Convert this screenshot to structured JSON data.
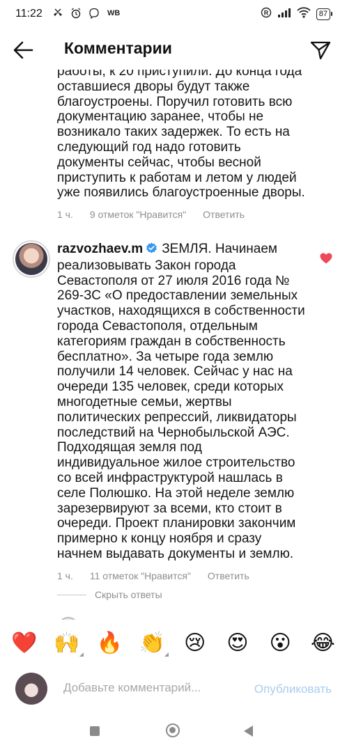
{
  "status_bar": {
    "time": "11:22",
    "carrier_tag": "WB",
    "battery_level": "87"
  },
  "header": {
    "title": "Комментарии"
  },
  "comments": [
    {
      "text": "работы, к 20 приступили. До конца года оставшиеся дворы будут также благоустроены. Поручил готовить всю документацию заранее, чтобы не возникало таких задержек. То есть на следующий год надо готовить документы сейчас, чтобы весной приступить к работам и летом у людей уже появились благоустроенные дворы.",
      "time": "1 ч.",
      "likes": "9 отметок \"Нравится\"",
      "reply": "Ответить"
    },
    {
      "username": "razvozhaev.m",
      "text": "ЗЕМЛЯ. Начинаем реализовывать Закон города Севастополя от 27 июля 2016 года № 269-ЗС «О предоставлении земельных участков, находящихся в собственности города Севастополя, отдельным категориям граждан в собственность бесплатно». За четыре года землю получили 14 человек. Сейчас у нас на очереди 135 человек, среди которых многодетные семьи, жертвы политических репрессий, ликвидаторы последствий на Чернобыльской АЭС. Подходящая земля под индивидуальное жилое строительство со всей инфраструктурой нашлась в селе Полюшко. На этой неделе землю зарезервируют за всеми, кто стоит в очереди. Проект планировки закончим примерно к концу ноября и сразу начнем выдавать документы и землю.",
      "time": "1 ч.",
      "likes": "11 отметок \"Нравится\"",
      "reply": "Ответить",
      "liked": true
    }
  ],
  "hide_replies": "Скрыть ответы",
  "emoji_bar": [
    "❤️",
    "🙌",
    "🔥",
    "👏",
    "😢",
    "😍",
    "😮",
    "😂"
  ],
  "composer": {
    "placeholder": "Добавьте комментарий...",
    "publish_label": "Опубликовать"
  },
  "colors": {
    "like_red": "#ed4956",
    "verified_blue": "#3897f0",
    "publish_disabled": "#a8cdef",
    "meta_gray": "#8e8e8e"
  }
}
